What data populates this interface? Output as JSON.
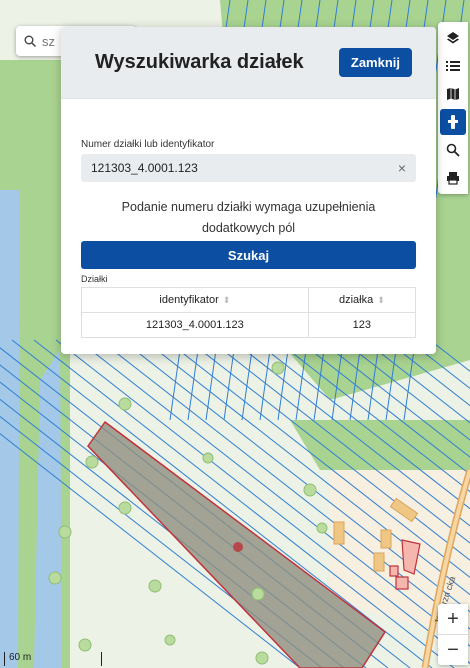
{
  "map": {
    "search_placeholder": "sz",
    "street_label": "Jaworzn cka",
    "scale_label": "60 m"
  },
  "toolbar": {
    "items": [
      {
        "icon": "layers-icon"
      },
      {
        "icon": "list-icon"
      },
      {
        "icon": "map-icon"
      },
      {
        "icon": "measure-icon",
        "active": true
      },
      {
        "icon": "search-icon"
      },
      {
        "icon": "print-icon"
      }
    ],
    "zoom_in": "+",
    "zoom_out": "−"
  },
  "modal": {
    "title": "Wyszukiwarka działek",
    "close_label": "Zamknij",
    "field_label": "Numer działki lub identyfikator",
    "field_value": "121303_4.0001.123",
    "clear_glyph": "×",
    "info_line1": "Podanie numeru działki wymaga uzupełnienia",
    "info_line2": "dodatkowych pól",
    "search_label": "Szukaj",
    "table_caption": "Działki",
    "columns": [
      "identyfikator",
      "działka"
    ],
    "rows": [
      {
        "identyfikator": "121303_4.0001.123",
        "dzialka": "123"
      }
    ]
  },
  "colors": {
    "accent": "#0b4ea2",
    "parcel_line": "#2f7fd3",
    "forest": "#a9d391",
    "water": "#a3c8e8",
    "selected_parcel": "#8f8e80",
    "selected_border": "#c0333c"
  }
}
